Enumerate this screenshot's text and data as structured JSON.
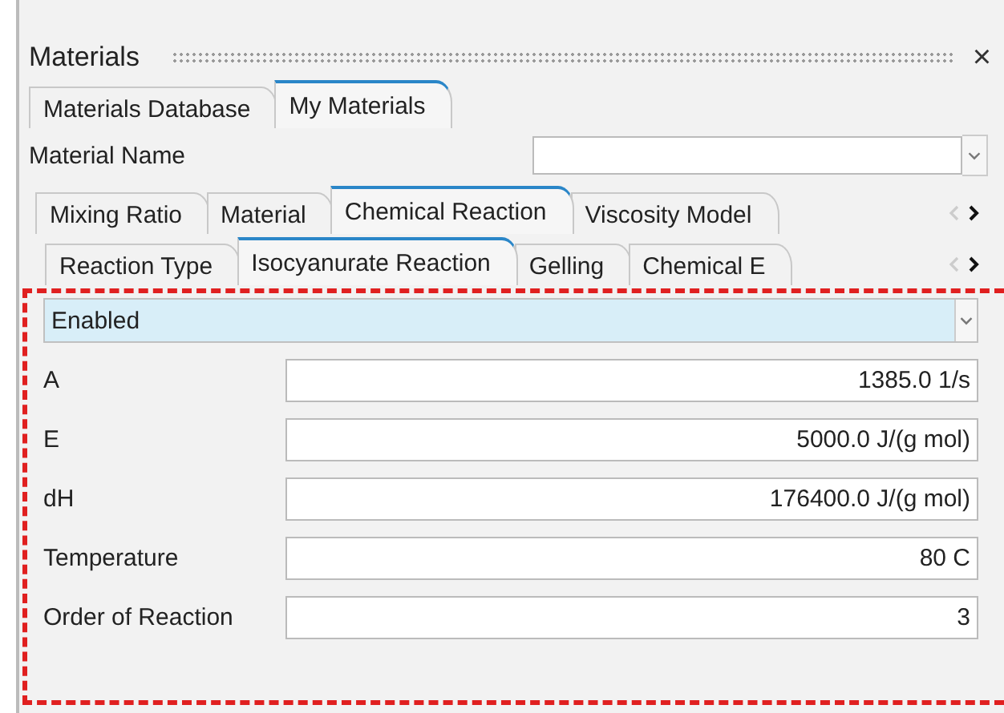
{
  "panel": {
    "title": "Materials",
    "close": "×"
  },
  "library_tabs": [
    {
      "label": "Materials Database",
      "selected": false
    },
    {
      "label": "My Materials",
      "selected": true
    }
  ],
  "material_name": {
    "label": "Material Name"
  },
  "category_tabs": [
    {
      "label": "Mixing Ratio",
      "selected": false
    },
    {
      "label": "Material",
      "selected": false
    },
    {
      "label": "Chemical Reaction",
      "selected": true
    },
    {
      "label": "Viscosity Model",
      "selected": false
    }
  ],
  "reaction_tabs": [
    {
      "label": "Reaction Type",
      "selected": false
    },
    {
      "label": "Isocyanurate Reaction",
      "selected": true
    },
    {
      "label": "Gelling",
      "selected": false
    },
    {
      "label": "Chemical E",
      "selected": false
    }
  ],
  "status": {
    "value": "Enabled"
  },
  "parameters": [
    {
      "label": "A",
      "value": "1385.0 1/s"
    },
    {
      "label": "E",
      "value": "5000.0 J/(g mol)"
    },
    {
      "label": "dH",
      "value": "176400.0 J/(g mol)"
    },
    {
      "label": "Temperature",
      "value": "80 C"
    },
    {
      "label": "Order of Reaction",
      "value": "3"
    }
  ]
}
